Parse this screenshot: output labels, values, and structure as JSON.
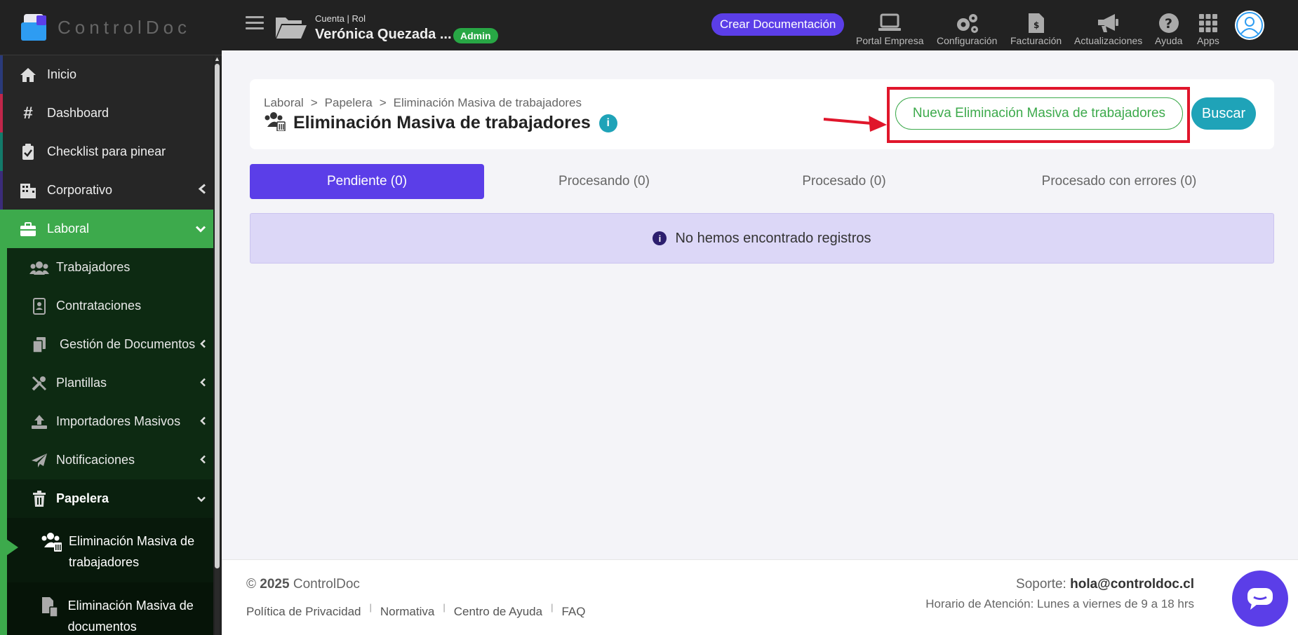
{
  "brand": {
    "name": "ControlDoc"
  },
  "topbar": {
    "account_label": "Cuenta | Rol",
    "account_name": "Verónica Quezada ...",
    "role_badge": "Admin",
    "create_button": "Crear Documentación",
    "items": [
      {
        "label": "Portal Empresa",
        "icon": "laptop-icon"
      },
      {
        "label": "Configuración",
        "icon": "gears-icon"
      },
      {
        "label": "Facturación",
        "icon": "invoice-icon"
      },
      {
        "label": "Actualizaciones",
        "icon": "megaphone-icon"
      },
      {
        "label": "Ayuda",
        "icon": "question-icon"
      },
      {
        "label": "Apps",
        "icon": "grid-icon"
      }
    ]
  },
  "sidebar": {
    "items": [
      {
        "label": "Inicio",
        "icon": "home-icon"
      },
      {
        "label": "Dashboard",
        "icon": "hash-icon"
      },
      {
        "label": "Checklist para pinear",
        "icon": "clipboard-check-icon"
      },
      {
        "label": "Corporativo",
        "icon": "building-icon"
      },
      {
        "label": "Laboral",
        "icon": "briefcase-icon"
      }
    ],
    "laboral_items": [
      {
        "label": "Trabajadores",
        "icon": "users-icon"
      },
      {
        "label": "Contrataciones",
        "icon": "contact-book-icon"
      },
      {
        "label": "Gestión de Documentos",
        "icon": "copy-icon"
      },
      {
        "label": "Plantillas",
        "icon": "tools-icon"
      },
      {
        "label": "Importadores Masivos",
        "icon": "upload-icon"
      },
      {
        "label": "Notificaciones",
        "icon": "paper-plane-icon"
      },
      {
        "label": "Papelera",
        "icon": "trash-icon"
      }
    ],
    "papelera_items": [
      {
        "label": "Eliminación Masiva de trabajadores",
        "icon": "users-trash-icon"
      },
      {
        "label": "Eliminación Masiva de documentos",
        "icon": "file-trash-icon"
      }
    ]
  },
  "page": {
    "breadcrumb": [
      "Laboral",
      ">",
      "Papelera",
      ">",
      "Eliminación Masiva de trabajadores"
    ],
    "title": "Eliminación Masiva de trabajadores",
    "info_icon": "i",
    "new_button": "Nueva Eliminación Masiva de trabajadores",
    "search_button": "Buscar",
    "tabs": [
      {
        "label": "Pendiente (0)"
      },
      {
        "label": "Procesando (0)"
      },
      {
        "label": "Procesado (0)"
      },
      {
        "label": "Procesado con errores (0)"
      }
    ],
    "empty_message": "No hemos encontrado registros"
  },
  "footer": {
    "copyright_symbol": "©",
    "year": "2025",
    "company": "ControlDoc",
    "links": [
      "Política de Privacidad",
      "Normativa",
      "Centro de Ayuda",
      "FAQ"
    ],
    "separator": "|",
    "support_label": "Soporte:",
    "support_email": "hola@controldoc.cl",
    "hours": "Horario de Atención: Lunes a viernes de 9 a 18 hrs"
  },
  "colors": {
    "accent": "#5b3ee8",
    "laboral_green": "#3daa4c",
    "teal": "#1fa3b8",
    "highlight_red": "#e0162b"
  }
}
